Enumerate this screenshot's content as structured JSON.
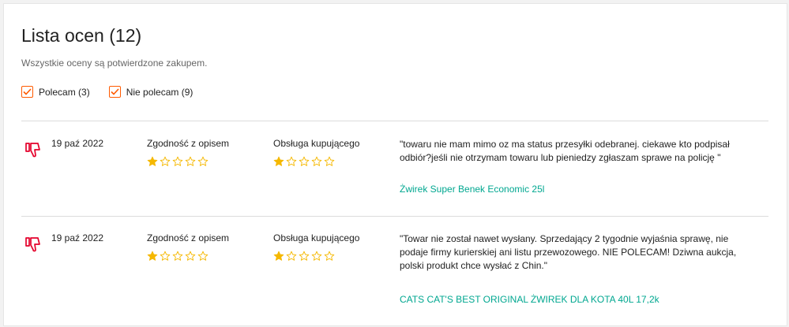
{
  "header": {
    "title": "Lista ocen (12)",
    "subtitle": "Wszystkie oceny są potwierdzone zakupem."
  },
  "filters": [
    {
      "label": "Polecam (3)",
      "checked": true
    },
    {
      "label": "Nie polecam (9)",
      "checked": true
    }
  ],
  "colors": {
    "accent": "#ff5a00",
    "link": "#00a790",
    "negative": "#e4002b",
    "star": "#f5b800"
  },
  "columns": {
    "description_label": "Zgodność z opisem",
    "service_label": "Obsługa kupującego"
  },
  "reviews": [
    {
      "icon": "thumbs-down-icon",
      "date": "19 paź 2022",
      "description_rating": 1,
      "service_rating": 1,
      "max_rating": 5,
      "text": "\"towaru nie mam mimo oz ma status przesyłki odebranej. ciekawe kto podpisał odbiór?jeśli nie otrzymam towaru lub pieniedzy zgłaszam sprawe na policję \"",
      "product": "Żwirek Super Benek Economic 25l"
    },
    {
      "icon": "thumbs-down-icon",
      "date": "19 paź 2022",
      "description_rating": 1,
      "service_rating": 1,
      "max_rating": 5,
      "text": "\"Towar nie został nawet wysłany. Sprzedający 2 tygodnie wyjaśnia sprawę, nie podaje firmy kurierskiej ani listu przewozowego. NIE POLECAM! Dziwna aukcja, polski produkt chce wysłać z Chin.\"",
      "product": "CATS CAT'S BEST ORIGINAL ŻWIREK DLA KOTA 40L 17,2k"
    }
  ]
}
